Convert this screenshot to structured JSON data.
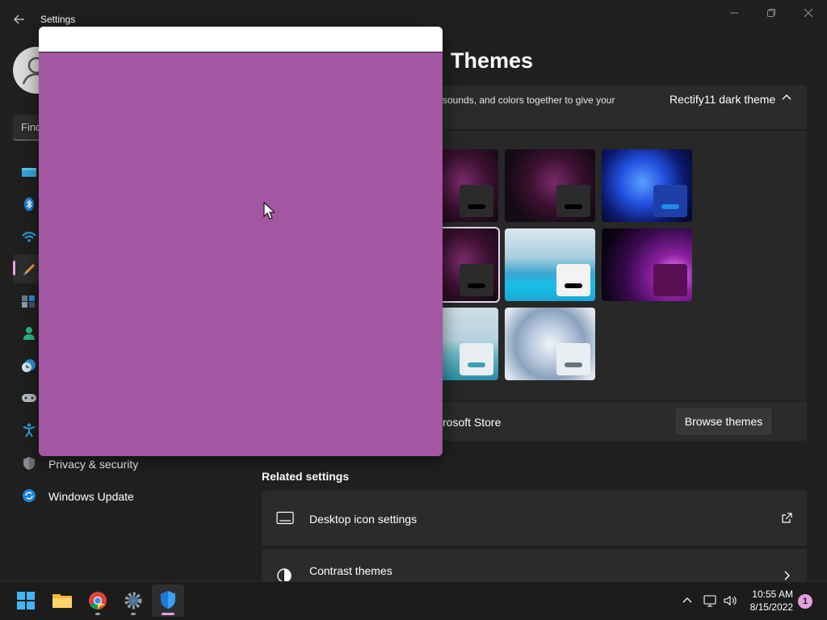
{
  "window": {
    "title": "Settings",
    "back_icon": "back-arrow-icon",
    "controls": [
      "minimize-icon",
      "maximize-icon",
      "close-icon"
    ]
  },
  "sidebar": {
    "search_placeholder": "Find",
    "items": [
      {
        "icon": "system-icon",
        "label": ""
      },
      {
        "icon": "bluetooth-icon",
        "label": ""
      },
      {
        "icon": "network-icon",
        "label": ""
      },
      {
        "icon": "personalization-icon",
        "label": "",
        "active": true
      },
      {
        "icon": "apps-icon",
        "label": ""
      },
      {
        "icon": "accounts-icon",
        "label": ""
      },
      {
        "icon": "time-language-icon",
        "label": ""
      },
      {
        "icon": "gaming-icon",
        "label": ""
      },
      {
        "icon": "accessibility-icon",
        "label": ""
      },
      {
        "icon": "privacy-shield-icon",
        "label": "Privacy & security"
      },
      {
        "icon": "windows-update-icon",
        "label": "Windows Update"
      }
    ]
  },
  "main": {
    "page_title": "Themes",
    "current_theme": {
      "description": "sounds, and colors together to give your",
      "name": "Rectify11 dark theme"
    },
    "store": {
      "text": "rosoft Store",
      "button": "Browse themes"
    },
    "related": {
      "heading": "Related settings",
      "items": [
        {
          "label": "Desktop icon settings",
          "icon": "desktop-icon",
          "action_icon": "external-link-icon"
        },
        {
          "label": "Contrast themes",
          "icon": "contrast-icon",
          "action_icon": "chevron-right-icon"
        }
      ]
    }
  },
  "taskbar": {
    "apps": [
      "start-icon",
      "file-explorer-icon",
      "chrome-icon",
      "settings-gear-icon",
      "defender-shield-icon"
    ],
    "tray_icons": [
      "chevron-up-icon",
      "network-icon",
      "volume-icon"
    ],
    "time": "10:55 AM",
    "date": "8/15/2022",
    "notification_count": "1"
  },
  "colors": {
    "background": "#202020",
    "card": "#2b2b2b",
    "accent": "#e59fe0",
    "overlay_fill": "#a356a1"
  }
}
